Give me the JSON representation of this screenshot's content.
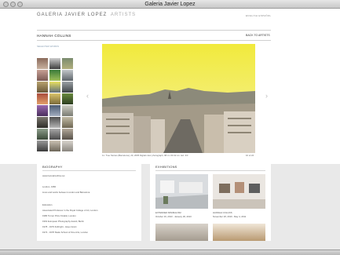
{
  "window": {
    "title": "Galeria Javier Lopez"
  },
  "header": {
    "logo_main": "GALERIA  JAVIER LOPEZ",
    "logo_sub": "ARTISTS",
    "languages": "ENGLISH  ESPAÑOL"
  },
  "artist": {
    "name": "HANNAH COLLINS",
    "back_label": "BACK TO ARTISTS"
  },
  "selected_label": "SELECTED WORKS",
  "gallery": {
    "caption": "11. True Stories (Barcelona), 20, 2005  Digital color photograph, 98.4 x 60.32 cm. Ed. 3/3",
    "counter": "10 of 24"
  },
  "biography": {
    "heading": "BIOGRAPHY",
    "lines": [
      "www.hannahcollins.net",
      "London, 1956",
      "Lives and works between London and Barcelona",
      "Education",
      "Associated Professor in the Royal College of Art, London",
      "1980 Turner Prize Finalist, London",
      "1991 European Photography Award, Berlin",
      "1978 - 1979 Fulbright - Hayo Grant",
      "1974 - 1978 Slade School of Fine Arts, London"
    ]
  },
  "exhibitions": {
    "heading": "EXHIBITIONS",
    "items": [
      {
        "title": "EXTENDED MINIMALISM",
        "dates": "October 16, 2013 - January 30, 2013"
      },
      {
        "title": "HANNAH COLLINS",
        "dates": "November 18, 2010 - May 4, 2011"
      }
    ]
  },
  "colors": {
    "hero_sky": "#f1ea3c",
    "grey_band": "#e9e9e9",
    "link_blue": "#8aa0b4"
  }
}
